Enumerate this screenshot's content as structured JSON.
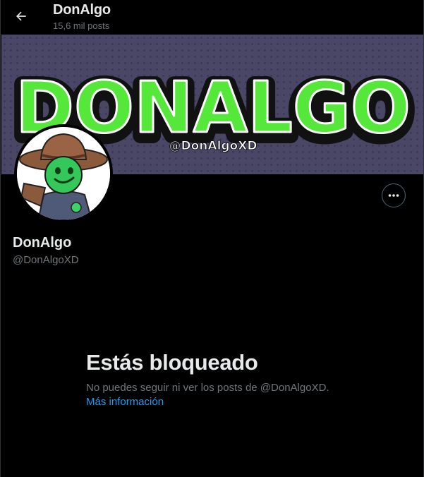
{
  "header": {
    "back_icon": "arrow-left-icon",
    "title": "DonAlgo",
    "post_count": "15,6 mil posts"
  },
  "banner": {
    "wordmark": "DONALGO",
    "handle_text": "@DonAlgoXD",
    "colors": {
      "background": "#4a4766",
      "wordmark": "#55e83a",
      "outline": "#111111"
    }
  },
  "profile": {
    "display_name": "DonAlgo",
    "handle": "@DonAlgoXD",
    "more_icon": "more-horizontal-icon"
  },
  "blocked": {
    "title": "Estás bloqueado",
    "message": "No puedes seguir ni ver los posts de @DonAlgoXD.",
    "link_label": "Más información"
  },
  "colors": {
    "background": "#000000",
    "text": "#e7e9ea",
    "muted": "#71767b",
    "link": "#1d9bf0"
  }
}
